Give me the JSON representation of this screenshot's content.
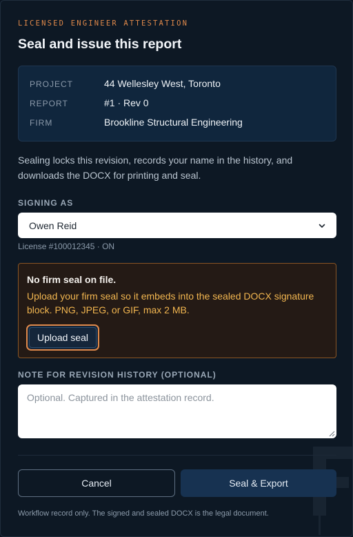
{
  "dialog": {
    "eyebrow": "LICENSED ENGINEER ATTESTATION",
    "title": "Seal and issue this report"
  },
  "summary": {
    "rows": [
      {
        "key": "PROJECT",
        "value": "44 Wellesley West, Toronto"
      },
      {
        "key": "REPORT",
        "value": "#1 · Rev 0"
      },
      {
        "key": "FIRM",
        "value": "Brookline Structural Engineering"
      }
    ]
  },
  "description": "Sealing locks this revision, records your name in the history, and downloads the DOCX for printing and seal.",
  "signing": {
    "label": "SIGNING AS",
    "selected": "Owen Reid",
    "license": "License #100012345 · ON"
  },
  "warning": {
    "title": "No firm seal on file.",
    "body": "Upload your firm seal so it embeds into the sealed DOCX signature block. PNG, JPEG, or GIF, max 2 MB.",
    "button_label": "Upload seal"
  },
  "note": {
    "label": "NOTE FOR REVISION HISTORY (OPTIONAL)",
    "value": "",
    "placeholder": "Optional. Captured in the attestation record."
  },
  "actions": {
    "cancel_label": "Cancel",
    "primary_label": "Seal & Export"
  },
  "footer": "Workflow record only. The signed and sealed DOCX is the legal document.",
  "colors": {
    "accent": "#e0894a",
    "warning_text": "#f2b650",
    "background": "#0d1824",
    "primary_button": "#173251"
  },
  "icons": {
    "select_arrow": "chevron-down-icon",
    "resize": "resize-grip-icon"
  }
}
